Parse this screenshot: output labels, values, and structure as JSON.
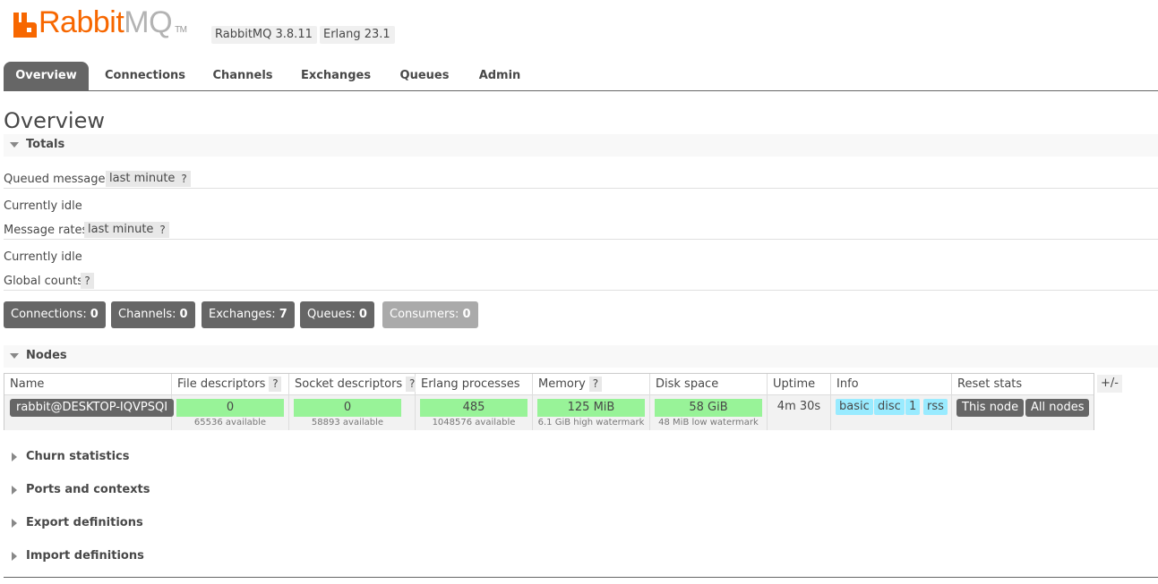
{
  "header": {
    "logo_rabbit": "Rabbit",
    "logo_mq": "MQ",
    "logo_tm": "TM",
    "rabbitmq_version": "RabbitMQ 3.8.11",
    "erlang_version": "Erlang 23.1",
    "brand_color": "#f76700"
  },
  "tabs": [
    {
      "label": "Overview",
      "active": true
    },
    {
      "label": "Connections",
      "active": false
    },
    {
      "label": "Channels",
      "active": false
    },
    {
      "label": "Exchanges",
      "active": false
    },
    {
      "label": "Queues",
      "active": false
    },
    {
      "label": "Admin",
      "active": false
    }
  ],
  "page": {
    "title": "Overview"
  },
  "totals": {
    "section_label": "Totals",
    "queued_messages_label": "Queued messages",
    "queued_messages_range": "last minute",
    "queued_status": "Currently idle",
    "message_rates_label": "Message rates",
    "message_rates_range": "last minute",
    "rates_status": "Currently idle",
    "global_counts_label": "Global counts",
    "help": "?"
  },
  "counts": [
    {
      "label": "Connections:",
      "value": "0"
    },
    {
      "label": "Channels:",
      "value": "0"
    },
    {
      "label": "Exchanges:",
      "value": "7"
    },
    {
      "label": "Queues:",
      "value": "0"
    },
    {
      "label": "Consumers:",
      "value": "0"
    }
  ],
  "nodes": {
    "section_label": "Nodes",
    "columns": {
      "name": "Name",
      "file_descriptors": "File descriptors",
      "socket_descriptors": "Socket descriptors",
      "erlang_processes": "Erlang processes",
      "memory": "Memory",
      "disk_space": "Disk space",
      "uptime": "Uptime",
      "info": "Info",
      "reset_stats": "Reset stats"
    },
    "plus_minus": "+/-",
    "row": {
      "name": "rabbit@DESKTOP-IQVPSQI",
      "file_descriptors": "0",
      "file_descriptors_sub": "65536 available",
      "socket_descriptors": "0",
      "socket_descriptors_sub": "58893 available",
      "erlang_processes": "485",
      "erlang_processes_sub": "1048576 available",
      "memory": "125 MiB",
      "memory_sub": "6.1 GiB high watermark",
      "disk_space": "58 GiB",
      "disk_space_sub": "48 MiB low watermark",
      "uptime": "4m 30s",
      "info_tags": [
        "basic",
        "disc",
        "1",
        "rss"
      ],
      "reset_this": "This node",
      "reset_all": "All nodes"
    }
  },
  "collapsed_sections": [
    "Churn statistics",
    "Ports and contexts",
    "Export definitions",
    "Import definitions"
  ]
}
